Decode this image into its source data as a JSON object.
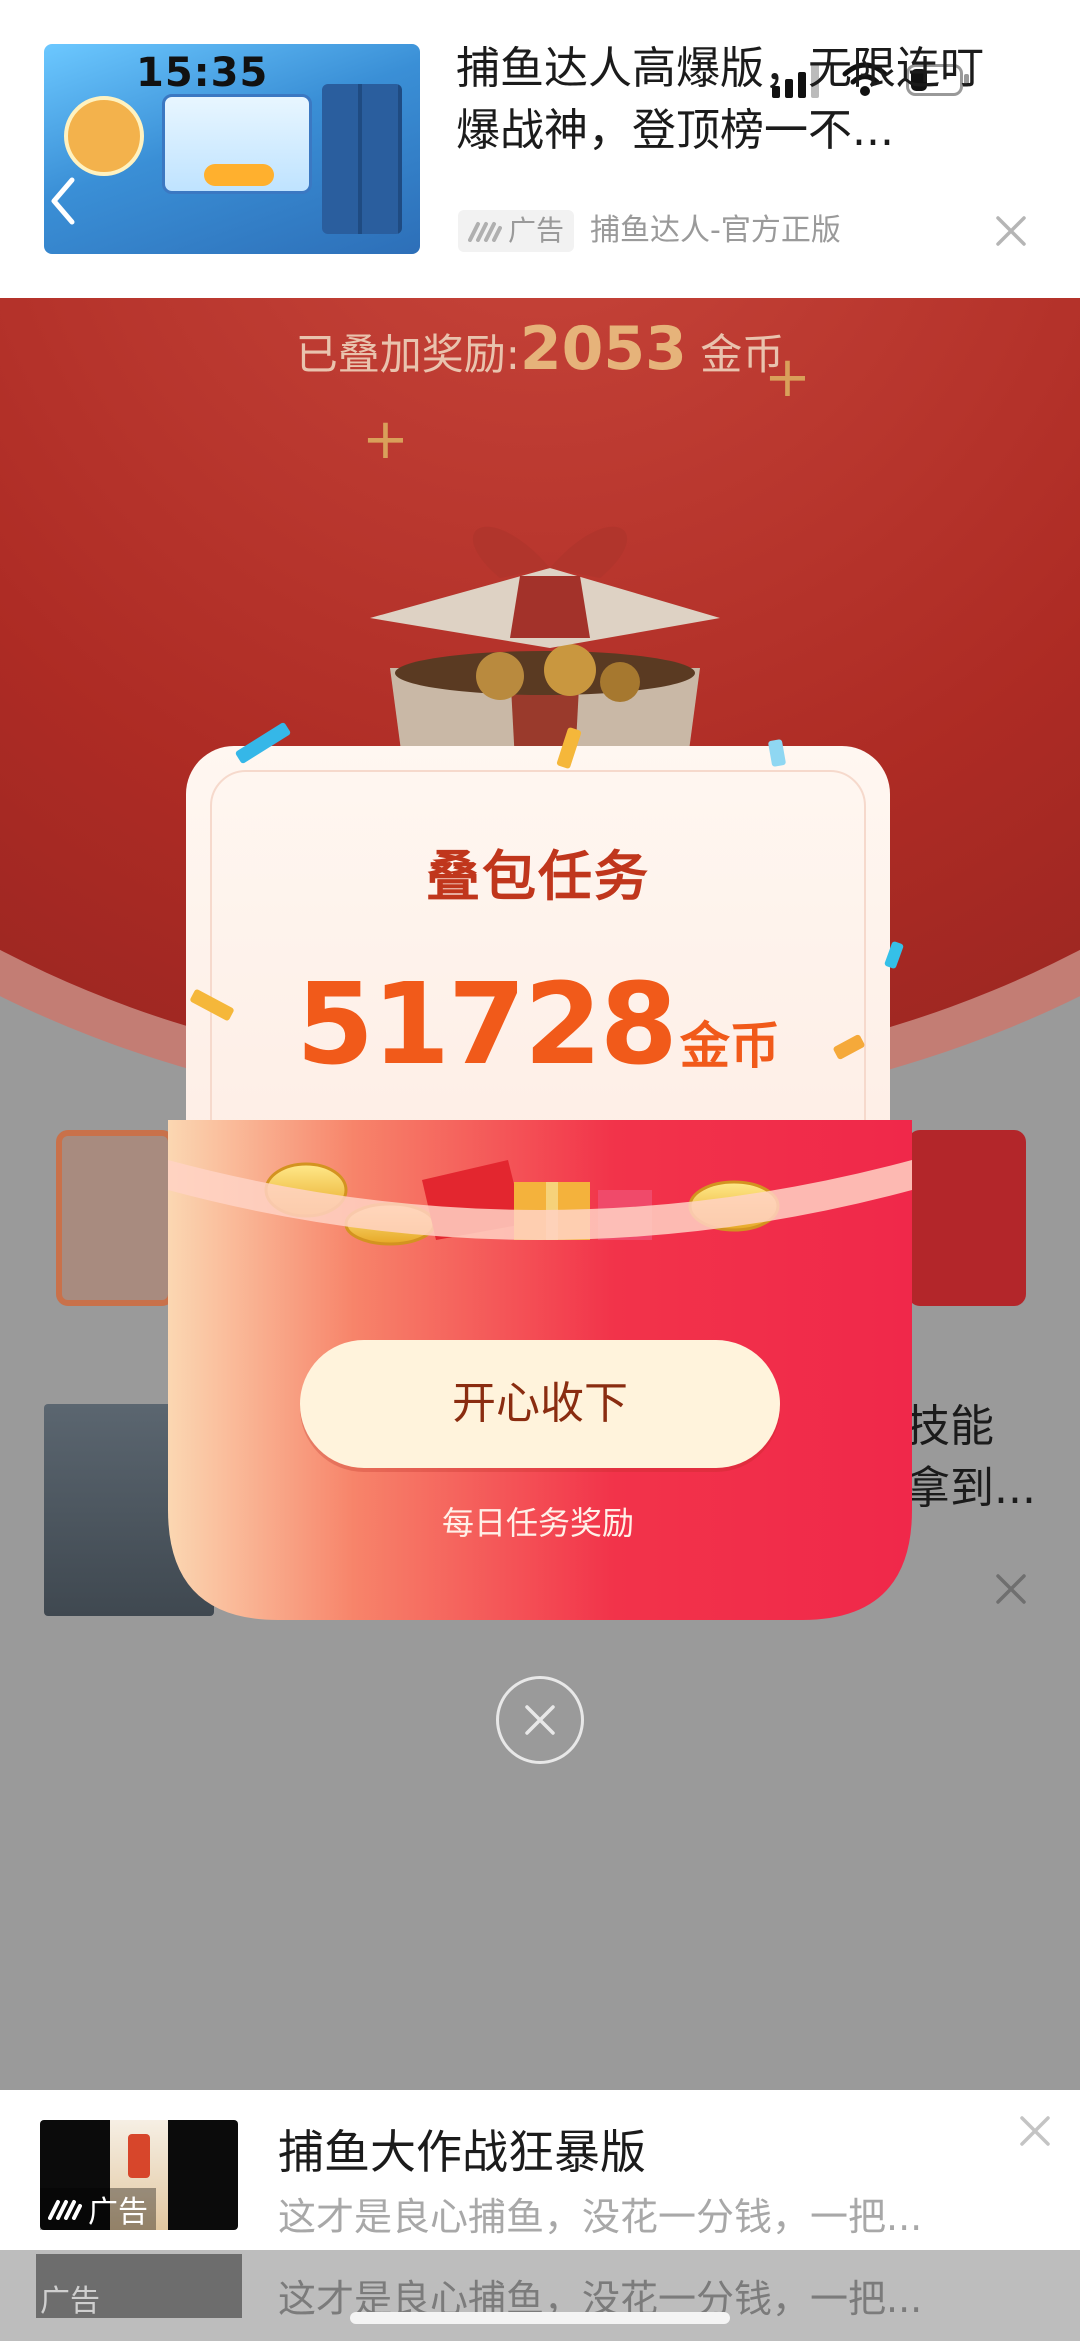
{
  "status_bar": {
    "time": "15:35"
  },
  "top_ad": {
    "title": "捕鱼达人高爆版，无限连叮爆战神，登顶榜一不...",
    "badge_label": "广告",
    "source": "捕鱼达人-官方正版"
  },
  "background": {
    "reward_prefix": "已叠加奖励:",
    "reward_amount": "2053",
    "reward_unit": "金币",
    "right_text_line1": "技能",
    "right_text_line2": "拿到..."
  },
  "modal": {
    "title": "叠包任务",
    "amount": "51728",
    "unit": "金币",
    "button_label": "开心收下",
    "subtitle": "每日任务奖励"
  },
  "bottom_ad": {
    "title": "捕鱼大作战狂暴版",
    "description": "这才是良心捕鱼，没花一分钱，一把...",
    "badge_label": "广告",
    "peek_text": "这才是良心捕鱼，没花一分钱，一把...",
    "peek_badge": "广告"
  },
  "colors": {
    "modal_title": "#c0361c",
    "modal_amount": "#f15a1a",
    "envelope_red": "#f2334a",
    "button_bg": "#fff3dc",
    "overlay": "#9a9a9a"
  },
  "icons": [
    "back-chevron-icon",
    "signal-icon",
    "wifi-icon",
    "battery-icon",
    "close-icon",
    "ad-logo-icon",
    "gift-box-icon",
    "coin-icon"
  ]
}
